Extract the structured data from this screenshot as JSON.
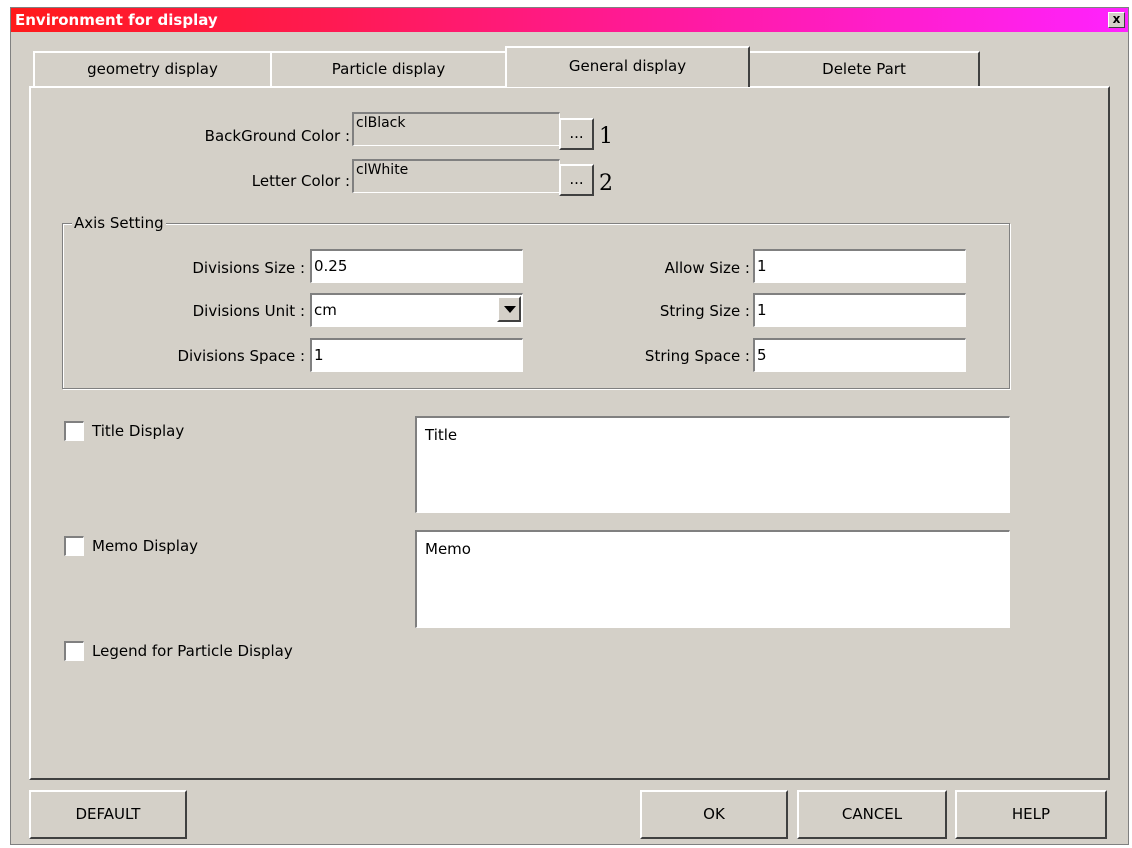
{
  "window": {
    "title": "Environment for display",
    "close_label": "x"
  },
  "tabs": [
    {
      "label": "geometry display"
    },
    {
      "label": "Particle display"
    },
    {
      "label": "General display"
    },
    {
      "label": "Delete Part"
    }
  ],
  "colors_section": {
    "background_label": "BackGround Color :",
    "background_value": "clBlack",
    "letter_label": "Letter Color :",
    "letter_value": "clWhite",
    "browse_label": "...",
    "annotation_1": "1",
    "annotation_2": "2"
  },
  "axis": {
    "group_title": "Axis Setting",
    "divisions_size_label": "Divisions Size :",
    "divisions_size_value": "0.25",
    "divisions_unit_label": "Divisions Unit :",
    "divisions_unit_value": "cm",
    "divisions_space_label": "Divisions Space :",
    "divisions_space_value": "1",
    "allow_size_label": "Allow Size :",
    "allow_size_value": "1",
    "string_size_label": "String Size :",
    "string_size_value": "1",
    "string_space_label": "String Space :",
    "string_space_value": "5"
  },
  "options": {
    "title_display_label": "Title Display",
    "title_text": "Title",
    "memo_display_label": "Memo Display",
    "memo_text": "Memo",
    "legend_label": "Legend for Particle Display"
  },
  "buttons": {
    "default": "DEFAULT",
    "ok": "OK",
    "cancel": "CANCEL",
    "help": "HELP"
  }
}
